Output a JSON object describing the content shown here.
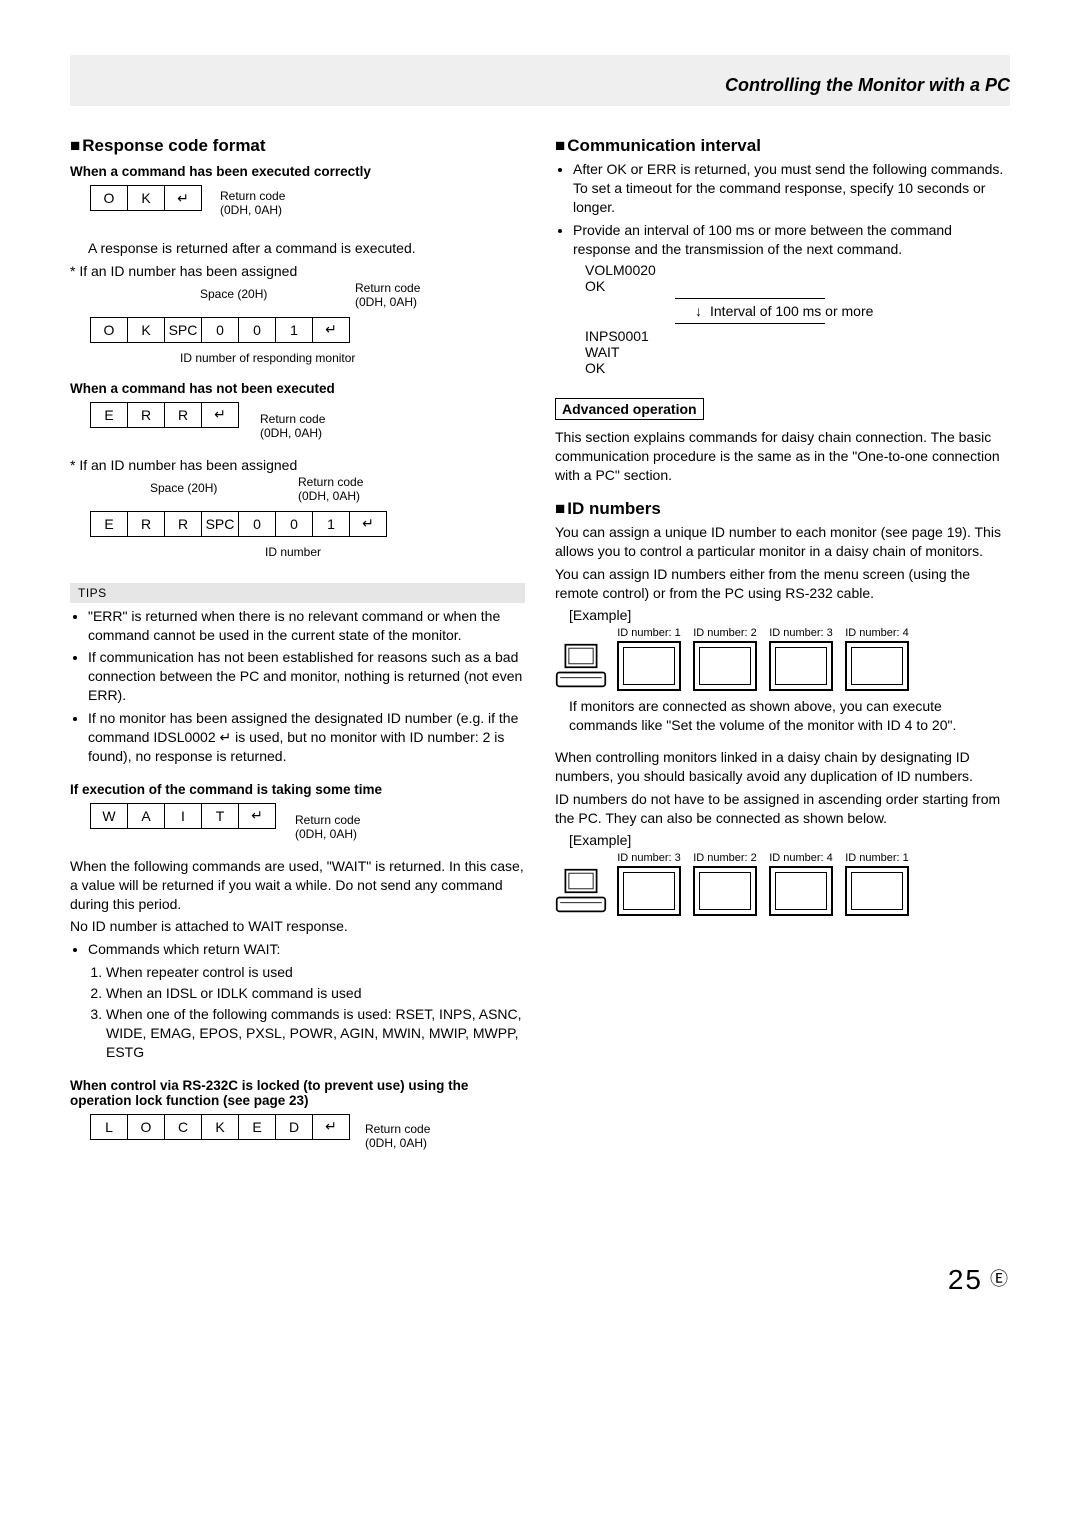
{
  "header": {
    "title": "Controlling the Monitor with a PC"
  },
  "left": {
    "h_response": "Response code format",
    "sub1": "When a command has been executed correctly",
    "t1": {
      "c0": "O",
      "c1": "K",
      "c2": "↵"
    },
    "ret_code": "Return code",
    "ret_code_hex": "(0DH, 0AH)",
    "p1": "A response is returned after a command is executed.",
    "star1": "*  If an ID number has been assigned",
    "space20": "Space (20H)",
    "t2": {
      "c0": "O",
      "c1": "K",
      "c2": "SPC",
      "c3": "0",
      "c4": "0",
      "c5": "1",
      "c6": "↵"
    },
    "id_resp": "ID number of responding monitor",
    "sub2": "When a command has not been executed",
    "t3": {
      "c0": "E",
      "c1": "R",
      "c2": "R",
      "c3": "↵"
    },
    "star2": "*  If an ID number has been assigned",
    "t4": {
      "c0": "E",
      "c1": "R",
      "c2": "R",
      "c3": "SPC",
      "c4": "0",
      "c5": "0",
      "c6": "1",
      "c7": "↵"
    },
    "id_num": "ID number",
    "tips_label": "TIPS",
    "tip1": "\"ERR\" is returned when there is no relevant command or when the command cannot be used in the current state of the monitor.",
    "tip2": "If communication has not been established for reasons such as a bad connection between the PC and monitor, nothing is returned (not even ERR).",
    "tip3": "If no monitor has been assigned the designated ID number (e.g. if the command IDSL0002 ↵ is used, but no monitor with ID number: 2 is found), no response is returned.",
    "sub3": "If execution of the command is taking some time",
    "t5": {
      "c0": "W",
      "c1": "A",
      "c2": "I",
      "c3": "T",
      "c4": "↵"
    },
    "wait_p1": "When the following commands are used, \"WAIT\" is returned. In this case, a value will be returned if you wait a while. Do not send any command during this period.",
    "wait_p2": "No ID number is attached to WAIT response.",
    "wait_bullet": "Commands which return WAIT:",
    "wait_li1": "When repeater control is used",
    "wait_li2": "When an IDSL or IDLK command is used",
    "wait_li3": "When one of the following commands is used: RSET, INPS, ASNC, WIDE, EMAG, EPOS, PXSL, POWR, AGIN, MWIN, MWIP, MWPP, ESTG",
    "sub4": "When control via RS-232C is locked (to prevent use) using the operation lock function (see page 23)",
    "t6": {
      "c0": "L",
      "c1": "O",
      "c2": "C",
      "c3": "K",
      "c4": "E",
      "c5": "D",
      "c6": "↵"
    }
  },
  "right": {
    "h_comm": "Communication interval",
    "b1": "After OK or ERR is returned, you must send the following commands.",
    "b1b": "To set a timeout for the command response, specify 10 seconds or longer.",
    "b2": "Provide an interval of 100 ms or more between the command response and the transmission of the next command.",
    "ex_volm": "VOLM0020",
    "ex_ok": "OK",
    "interval_label": "Interval of 100 ms or more",
    "ex_inps": "INPS0001",
    "ex_wait": "WAIT",
    "ex_ok2": "OK",
    "adv_op": "Advanced operation",
    "adv_p": "This section explains commands for daisy chain connection. The basic communication procedure is the same as in the \"One-to-one connection with a PC\" section.",
    "h_id": "ID numbers",
    "id_p1": "You can assign a unique ID number to each monitor (see page 19). This allows you to control a particular monitor in a daisy chain of monitors.",
    "id_p2": "You can assign ID numbers either from the menu screen (using the remote control) or from the PC using RS-232 cable.",
    "example_label": "[Example]",
    "ex1_labels": [
      "ID number: 1",
      "ID number: 2",
      "ID number: 3",
      "ID number: 4"
    ],
    "ex1_p": "If monitors are connected as shown above, you can execute commands like \"Set the volume of the monitor with ID 4 to 20\".",
    "id_p3": "When controlling monitors linked in a daisy chain by designating ID numbers, you should basically avoid any duplication of ID numbers.",
    "id_p4": "ID numbers do not have to be assigned in ascending order starting from the PC. They can also be connected as shown below.",
    "ex2_labels": [
      "ID number: 3",
      "ID number: 2",
      "ID number: 4",
      "ID number: 1"
    ]
  },
  "footer": {
    "page": "25",
    "circ": "E"
  }
}
